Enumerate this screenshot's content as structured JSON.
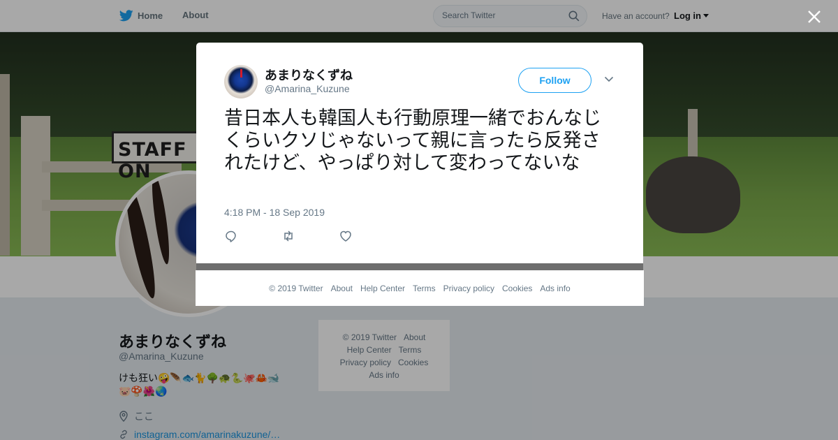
{
  "topbar": {
    "home_label": "Home",
    "about_label": "About",
    "search_placeholder": "Search Twitter",
    "have_account": "Have an account?",
    "login_label": "Log in"
  },
  "banner": {
    "sign_text": "STAFF ON"
  },
  "profile": {
    "name": "あまりなくずね",
    "handle": "@Amarina_Kuzune",
    "bio_line1": "けも狂い🤪🪶🐟🐈🌳🐢🐍🐙🦀🐋",
    "bio_line2": "🐷🍄🌺🌏",
    "location": "ここ",
    "link": "instagram.com/amarinakuzune/…"
  },
  "side_footer": {
    "copyright": "© 2019 Twitter",
    "about": "About",
    "help_center": "Help Center",
    "terms": "Terms",
    "privacy": "Privacy policy",
    "cookies": "Cookies",
    "ads_info": "Ads info"
  },
  "tweet": {
    "author_name": "あまりなくずね",
    "author_handle": "@Amarina_Kuzune",
    "follow_label": "Follow",
    "text": "昔日本人も韓国人も行動原理一緒でおんなじくらいクソじゃないって親に言ったら反発されたけど、やっぱり対して変わってないな",
    "timestamp": "4:18 PM - 18 Sep 2019"
  },
  "modal_footer": {
    "copyright": "© 2019 Twitter",
    "about": "About",
    "help_center": "Help Center",
    "terms": "Terms",
    "privacy": "Privacy policy",
    "cookies": "Cookies",
    "ads_info": "Ads info"
  },
  "icons": {
    "brand": "twitter-bird-icon",
    "search": "search-icon",
    "close": "close-icon",
    "reply": "reply-icon",
    "retweet": "retweet-icon",
    "like": "heart-icon",
    "caret": "chevron-down-icon",
    "location": "location-pin-icon",
    "link": "link-icon"
  },
  "colors": {
    "brand_blue": "#1da1f2",
    "link_blue": "#1b95e0",
    "text_secondary": "#657786"
  }
}
